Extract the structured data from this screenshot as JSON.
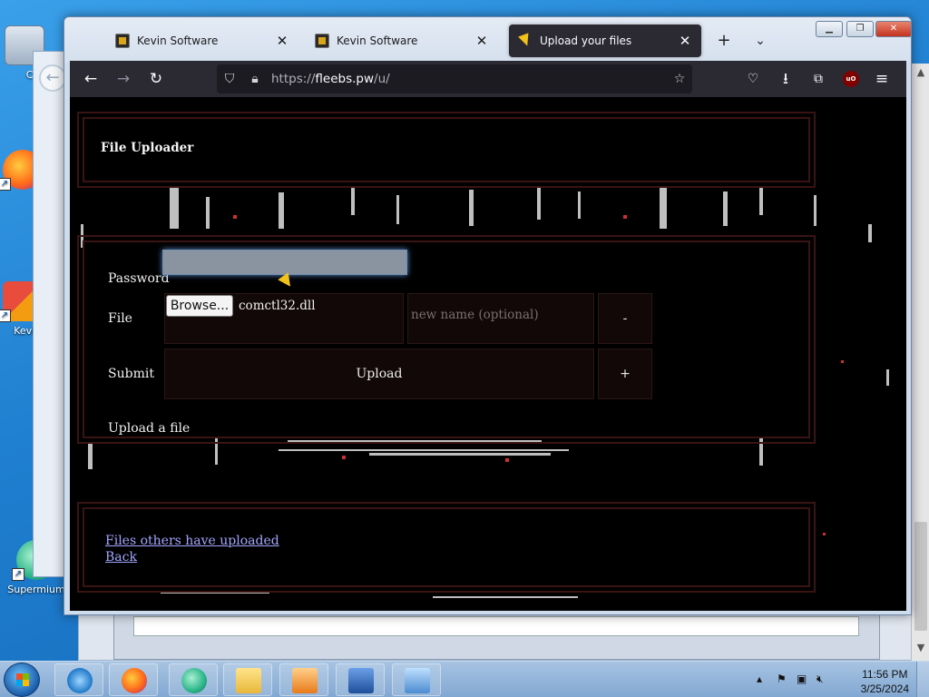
{
  "desktop": {
    "icons": [
      {
        "label": "Co"
      },
      {
        "label": "F"
      },
      {
        "label": "KevinC"
      },
      {
        "label": "Supermium"
      }
    ]
  },
  "browser": {
    "tabs": [
      {
        "label": "Kevin Software",
        "active": false
      },
      {
        "label": "Kevin Software",
        "active": false
      },
      {
        "label": "Upload your files",
        "active": true
      }
    ],
    "url": {
      "scheme": "https://",
      "host": "fleebs.pw",
      "path": "/u/"
    },
    "extension_badge": "uO"
  },
  "page": {
    "header_title": "File Uploader",
    "form": {
      "password_label": "Password",
      "file_label": "File",
      "browse_label": "Browse...",
      "selected_file": "comctl32.dll",
      "new_name_placeholder": "new name (optional)",
      "remove_label": "-",
      "submit_label": "Submit",
      "upload_label": "Upload",
      "add_label": "+",
      "caption": "Upload a file"
    },
    "links": {
      "others": "Files others have uploaded",
      "back": "Back"
    },
    "colors": {
      "background": "#000000",
      "border": "#3a1414",
      "link": "#a3a6ff",
      "cell": "#120808"
    }
  },
  "taskbar": {
    "clock_time": "11:56 PM",
    "clock_date": "3/25/2024",
    "pinned": [
      "internet-explorer",
      "firefox",
      "edge",
      "file-explorer",
      "media-player",
      "word",
      "control-panel"
    ]
  }
}
